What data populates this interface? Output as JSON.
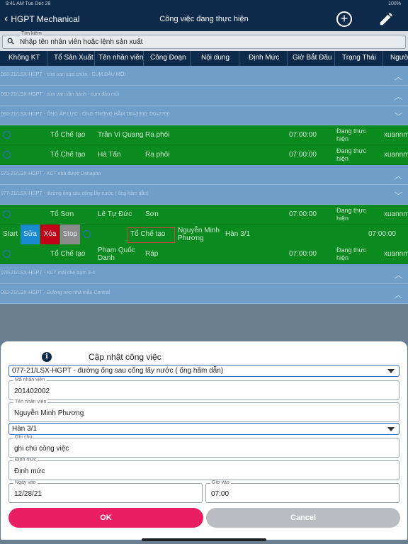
{
  "statusbar": {
    "time": "9:41 AM  Tue Dec 28",
    "battery": "100%"
  },
  "nav": {
    "back_label": "HGPT Mechanical",
    "title": "Công việc đang thực hiện"
  },
  "search": {
    "legend": "Tìm kiếm",
    "placeholder": "Nhập tên nhân viên hoặc lệnh sản xuất"
  },
  "columns": [
    "Không KT",
    "Tổ Sản Xuất",
    "Tên nhân viên",
    "Công Đoạn",
    "Nội dung",
    "Định Mức",
    "Giờ Bắt Đầu",
    "Trạng Thái",
    "Người"
  ],
  "groups": [
    "060-21/LSX-HGPT - cửa van sửa chữa - CỤM ĐẦU MỐI",
    "060-21/LSX-HGPT - cửa van vận hành - cụm đầu mối",
    "060-21/LSX-HGPT - ỐNG ÁP LỰC - ỐNG TRONG HẦM D0=3000; D0=2700",
    "073-21/LSX-HGPT - KCT nhà được Danapha",
    "077-21/LSX-HGPT - đường ống sau cống lấy nước ( ống hầm dẫn)",
    "078-21/LSX-HGPT - KCT mái che trạm 3-4",
    "083-21/LSX-HGPT - Bulong neo nhà mẫu Central"
  ],
  "rows": [
    {
      "team": "Tổ Chế tạo",
      "employee": "Trần Vi Quang",
      "stage": "Ra phôi",
      "start": "07:00:00",
      "status": "Đang thực hiện",
      "person": "xuannm"
    },
    {
      "team": "Tổ Chế tạo",
      "employee": "Hà Tấn",
      "stage": "Ra phôi",
      "start": "07:00:00",
      "status": "Đang thực hiện",
      "person": "xuannm"
    },
    {
      "team": "Tổ Sơn",
      "employee": "Lê Tự Đức",
      "stage": "Sơn",
      "start": "07:00:00",
      "status": "Đang thực hiện",
      "person": "xuannm"
    },
    {
      "team": "Tổ Chế tạo",
      "employee": "Phạm Quốc Danh",
      "stage": "Ráp",
      "start": "07:00:00",
      "status": "Đang thực hiện",
      "person": "xuannm"
    }
  ],
  "action_row": {
    "start": "Start",
    "edit": "Sửa",
    "delete": "Xóa",
    "stop": "Stop",
    "team": "Tổ Chế tạo",
    "employee": "Nguyễn Minh Phương",
    "stage": "Hàn 3/1",
    "start_time": "07:00:00"
  },
  "colors": {
    "nav": "#0d2a4a",
    "group": "#6f9fc9",
    "row": "#0a8a1f",
    "edit": "#1b8bd0",
    "delete": "#c00018",
    "stop": "#8a8a8a",
    "ok": "#e91e63",
    "cancel": "#b9bcc0"
  },
  "modal": {
    "title": "Cập nhật công việc",
    "order_select": "077-21/LSX-HGPT - đường ống sau cống lấy nước ( ống hầm dẫn)",
    "employee_id": {
      "label": "Mã nhân viên",
      "value": "201402002"
    },
    "employee_name": {
      "label": "Tên nhân viên",
      "value": "Nguyễn Minh Phương"
    },
    "stage_select": "Hàn 3/1",
    "note": {
      "label": "Ghi chú",
      "value": "ghi chú công việc"
    },
    "quota": {
      "label": "Định mức",
      "value": "Định mức"
    },
    "date_in": {
      "label": "Ngày vào",
      "value": "12/28/21"
    },
    "time_in": {
      "label": "Giờ vào",
      "value": "07:00"
    },
    "ok": "OK",
    "cancel": "Cancel"
  }
}
